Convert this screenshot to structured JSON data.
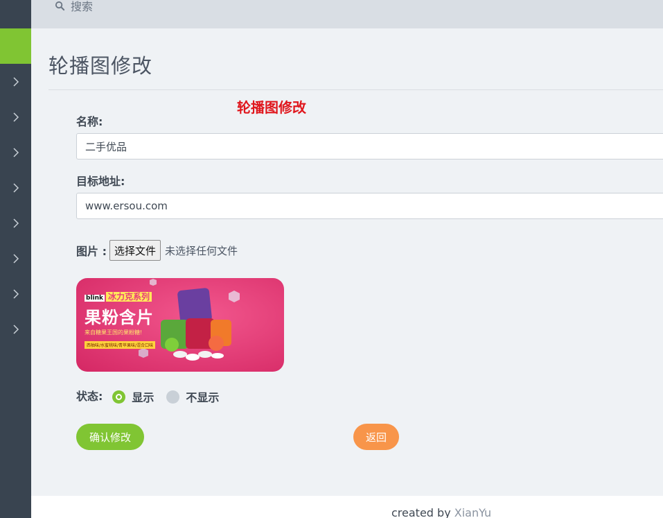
{
  "topbar": {
    "search_label": "搜索"
  },
  "page": {
    "title": "轮播图修改"
  },
  "form": {
    "heading": "轮播图修改",
    "name_label": "名称:",
    "name_value": "二手优品",
    "url_label": "目标地址:",
    "url_value": "www.ersou.com",
    "image_label": "图片 :",
    "file_button_label": "选择文件",
    "file_status": "未选择任何文件",
    "banner": {
      "brand": "blink",
      "series": "冰力克系列",
      "headline": "果粉含片",
      "subline": "来自糖果王国的果粉糖!",
      "tags": "西柚味/水蜜桃味/青苹果味/混合口味"
    },
    "status_label": "状态:",
    "status_options": [
      "显示",
      "不显示"
    ],
    "status_selected": "显示",
    "confirm_label": "确认修改",
    "back_label": "返回"
  },
  "footer": {
    "prefix": "created by ",
    "author": "XianYu"
  },
  "colors": {
    "accent": "#80c533",
    "back": "#f8954a",
    "heading_red": "#e0171d",
    "sidebar": "#394450",
    "banner": "#e63d78"
  }
}
